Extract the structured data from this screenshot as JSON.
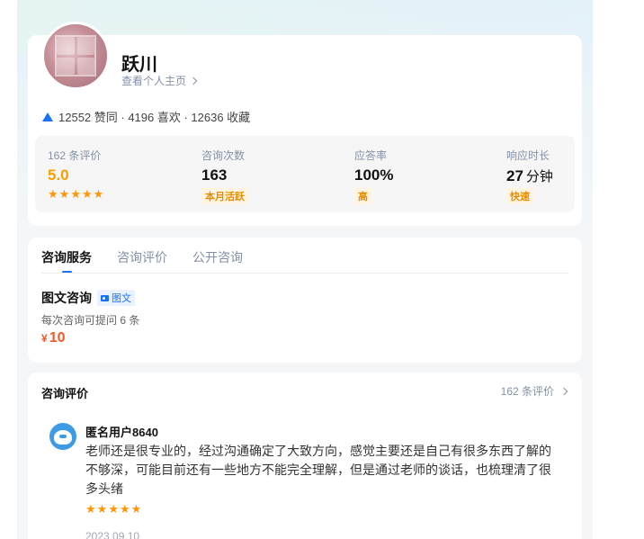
{
  "profile": {
    "name": "跃川",
    "homepage_link": "查看个人主页",
    "stats_line": "12552 赞同 · 4196 喜欢 · 12636 收藏"
  },
  "metrics": [
    {
      "label": "162 条评价",
      "value": "5.0",
      "stars": 5
    },
    {
      "label": "咨询次数",
      "value": "163",
      "tag": "本月活跃"
    },
    {
      "label": "应答率",
      "value": "100%",
      "tag": "高"
    },
    {
      "label": "响应时长",
      "value": "27",
      "unit": "分钟",
      "tag": "快速"
    }
  ],
  "tabs": [
    {
      "label": "咨询服务",
      "active": true
    },
    {
      "label": "咨询评价",
      "active": false
    },
    {
      "label": "公开咨询",
      "active": false
    }
  ],
  "service": {
    "title": "图文咨询",
    "badge": "图文",
    "description": "每次咨询可提问 6 条",
    "currency": "¥",
    "price": "10"
  },
  "reviews": {
    "title": "咨询评价",
    "count_link": "162 条评价",
    "items": [
      {
        "user": "匿名用户8640",
        "text": "老师还是很专业的，经过沟通确定了大致方向，感觉主要还是自己有很多东西了解的不够深，可能目前还有一些地方不能完全理解，但是通过老师的谈话，也梳理清了很多头绪",
        "rating": 5,
        "date": "2023.09.10"
      }
    ]
  },
  "colors": {
    "accent": "#1772f6",
    "star": "#ff9607",
    "price": "#f1592a",
    "tag_text": "#e58d00"
  }
}
